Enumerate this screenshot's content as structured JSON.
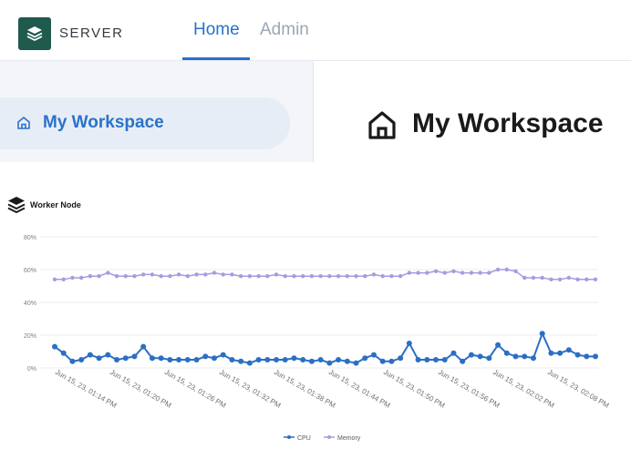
{
  "header": {
    "brand": "SERVER",
    "tabs": [
      {
        "label": "Home",
        "active": true
      },
      {
        "label": "Admin",
        "active": false
      }
    ]
  },
  "sidebar": {
    "items": [
      {
        "label": "My Workspace",
        "icon": "home-icon",
        "selected": true
      }
    ]
  },
  "main": {
    "title": "My Workspace",
    "icon": "home-icon"
  },
  "panel": {
    "title": "Worker Node",
    "icon": "layers-icon"
  },
  "colors": {
    "accent": "#2a72c8",
    "cpu": "#2b6fc4",
    "memory": "#a79be0"
  },
  "chart_data": {
    "type": "line",
    "ylim": [
      0,
      80
    ],
    "yticks": [
      "80%",
      "60%",
      "40%",
      "20%",
      "0%"
    ],
    "x_tick_labels": [
      "Jun 15, 23, 01:14 PM",
      "Jun 15, 23, 01:20 PM",
      "Jun 15, 23, 01:26 PM",
      "Jun 15, 23, 01:32 PM",
      "Jun 15, 23, 01:38 PM",
      "Jun 15, 23, 01:44 PM",
      "Jun 15, 23, 01:50 PM",
      "Jun 15, 23, 01:56 PM",
      "Jun 15, 23, 02:02 PM",
      "Jun 15, 23, 02:08 PM"
    ],
    "grid": true,
    "legend": "bottom",
    "series": [
      {
        "name": "CPU",
        "values": [
          13,
          9,
          4,
          5,
          8,
          6,
          8,
          5,
          6,
          7,
          13,
          6,
          6,
          5,
          5,
          5,
          5,
          7,
          6,
          8,
          5,
          4,
          3,
          5,
          5,
          5,
          5,
          6,
          5,
          4,
          5,
          3,
          5,
          4,
          3,
          6,
          8,
          4,
          4,
          6,
          15,
          5,
          5,
          5,
          5,
          9,
          4,
          8,
          7,
          6,
          14,
          9,
          7,
          7,
          6,
          21,
          9,
          9,
          11,
          8,
          7,
          7
        ]
      },
      {
        "name": "Memory",
        "values": [
          54,
          54,
          55,
          55,
          56,
          56,
          58,
          56,
          56,
          56,
          57,
          57,
          56,
          56,
          57,
          56,
          57,
          57,
          58,
          57,
          57,
          56,
          56,
          56,
          56,
          57,
          56,
          56,
          56,
          56,
          56,
          56,
          56,
          56,
          56,
          56,
          57,
          56,
          56,
          56,
          58,
          58,
          58,
          59,
          58,
          59,
          58,
          58,
          58,
          58,
          60,
          60,
          59,
          55,
          55,
          55,
          54,
          54,
          55,
          54,
          54,
          54
        ]
      }
    ]
  }
}
